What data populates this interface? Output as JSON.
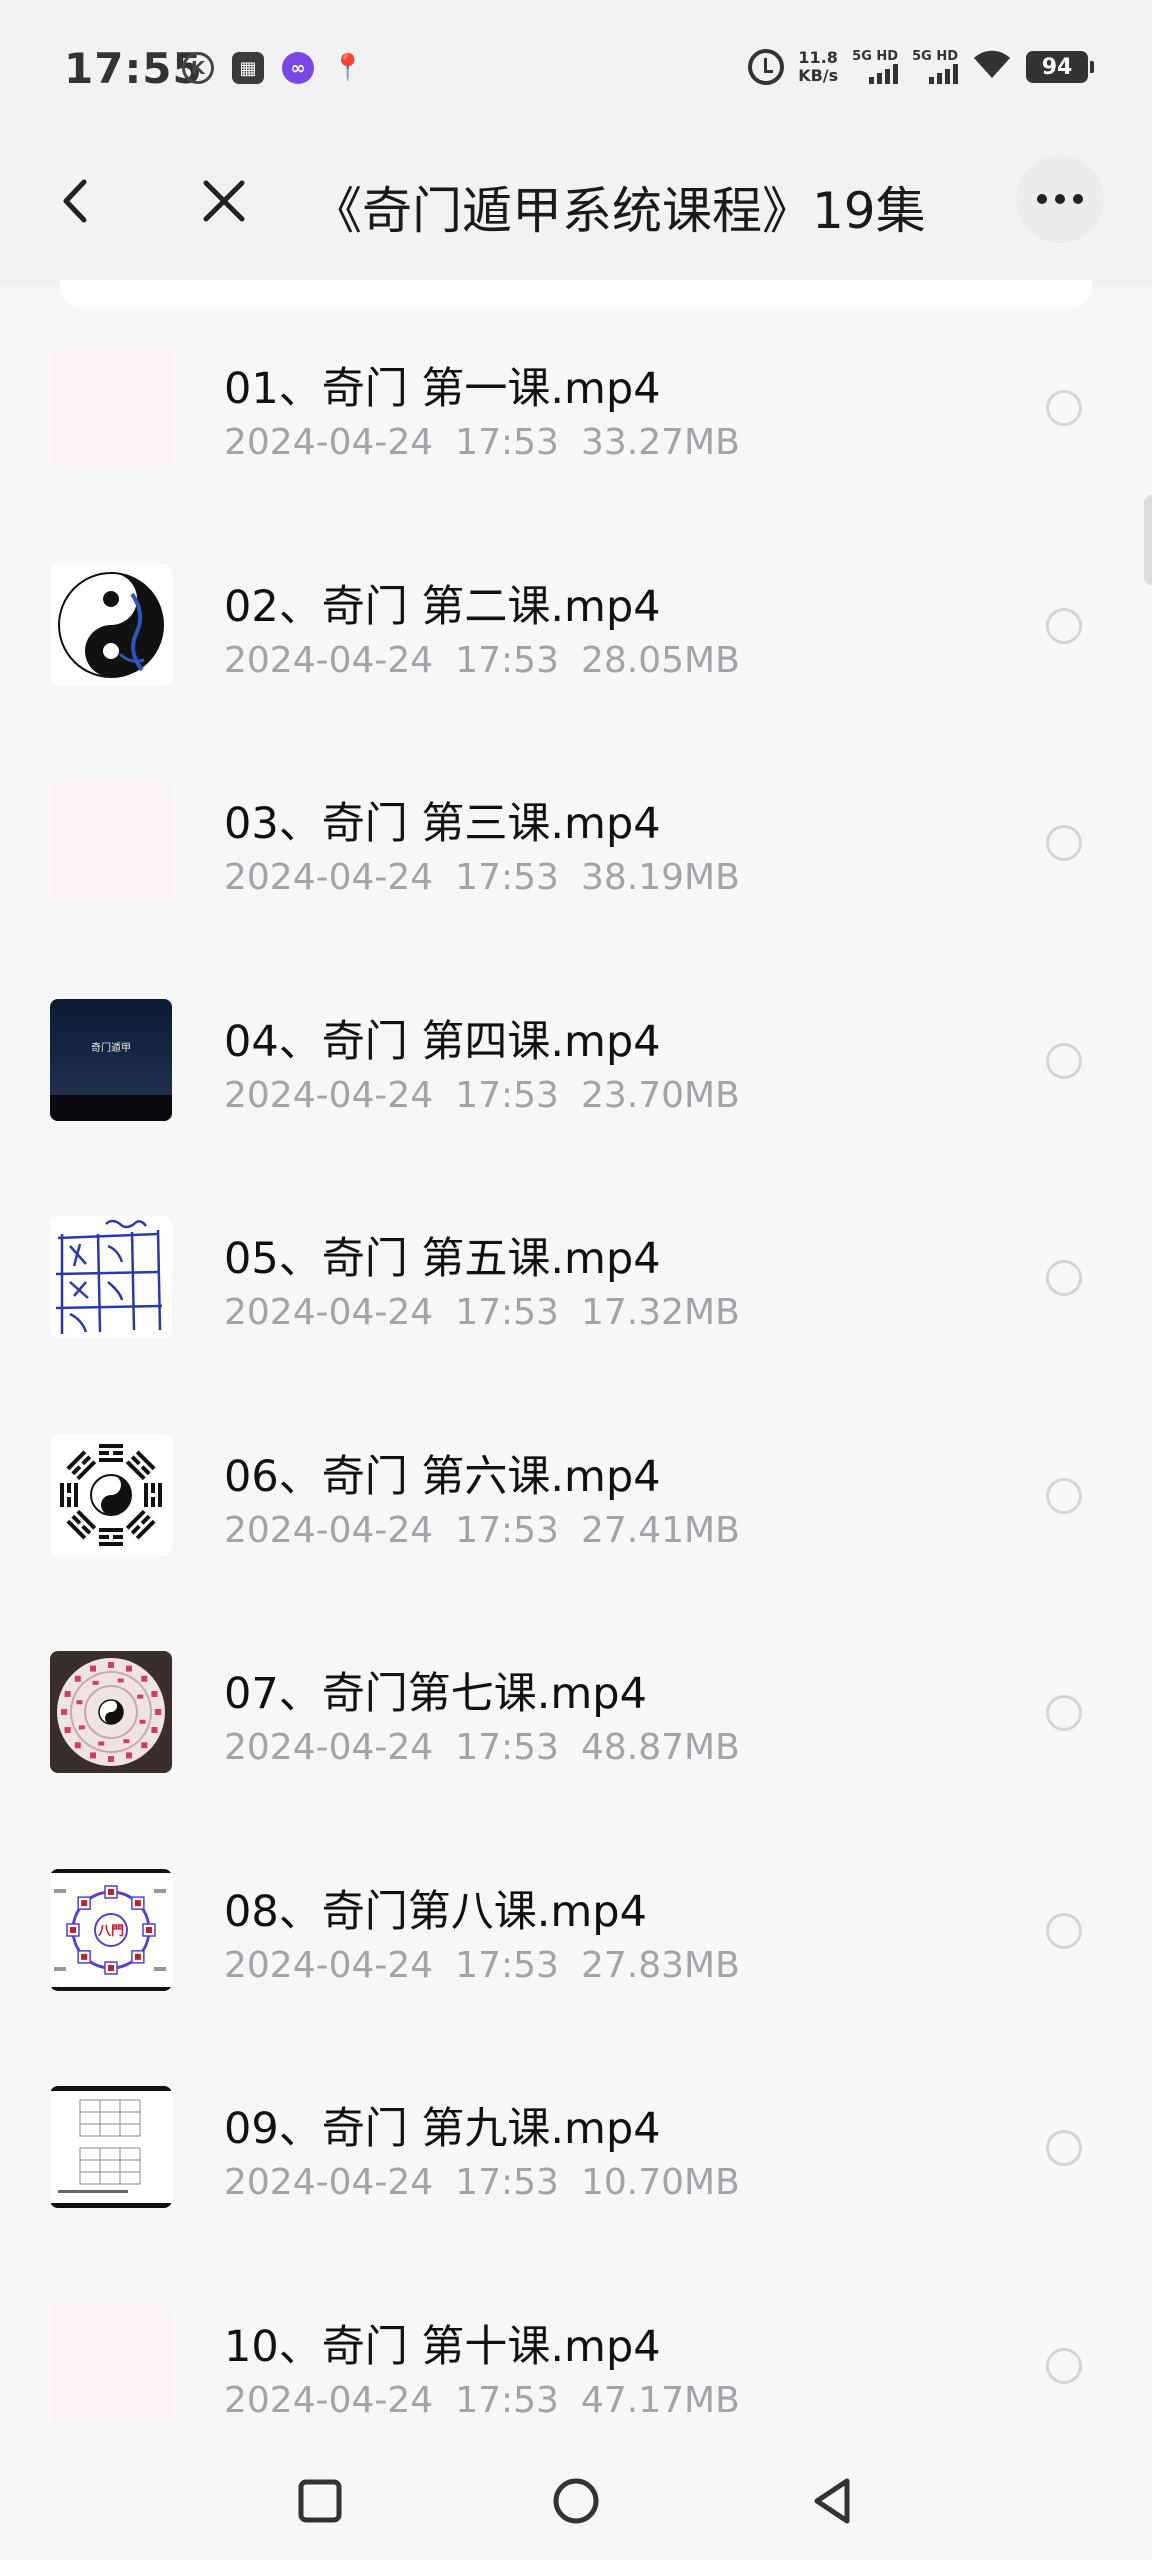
{
  "status_bar": {
    "time": "17:55",
    "left_icons": [
      "k-circle-icon",
      "gallery-icon",
      "link-app-icon",
      "location-pin-icon"
    ],
    "speed_value": "11.8",
    "speed_unit": "KB/s",
    "signal1_label": "5G HD",
    "signal2_label": "5G HD",
    "battery": "94"
  },
  "header": {
    "title": "《奇门遁甲系统课程》19集",
    "back_icon": "chevron-left-icon",
    "close_icon": "close-icon",
    "more_icon": "more-horizontal-icon"
  },
  "files": [
    {
      "name": "01、奇门 第一课.mp4",
      "date": "2024-04-24",
      "time": "17:53",
      "size": "33.27MB",
      "thumb": "blank"
    },
    {
      "name": "02、奇门 第二课.mp4",
      "date": "2024-04-24",
      "time": "17:53",
      "size": "28.05MB",
      "thumb": "taiji"
    },
    {
      "name": "03、奇门 第三课.mp4",
      "date": "2024-04-24",
      "time": "17:53",
      "size": "38.19MB",
      "thumb": "blank"
    },
    {
      "name": "04、奇门 第四课.mp4",
      "date": "2024-04-24",
      "time": "17:53",
      "size": "23.70MB",
      "thumb": "dark-sky"
    },
    {
      "name": "05、奇门 第五课.mp4",
      "date": "2024-04-24",
      "time": "17:53",
      "size": "17.32MB",
      "thumb": "handwritten-grid"
    },
    {
      "name": "06、奇门 第六课.mp4",
      "date": "2024-04-24",
      "time": "17:53",
      "size": "27.41MB",
      "thumb": "bagua"
    },
    {
      "name": "07、奇门第七课.mp4",
      "date": "2024-04-24",
      "time": "17:53",
      "size": "48.87MB",
      "thumb": "compass"
    },
    {
      "name": "08、奇门第八课.mp4",
      "date": "2024-04-24",
      "time": "17:53",
      "size": "27.83MB",
      "thumb": "bamen"
    },
    {
      "name": "09、奇门 第九课.mp4",
      "date": "2024-04-24",
      "time": "17:53",
      "size": "10.70MB",
      "thumb": "table-doc"
    },
    {
      "name": "10、奇门 第十课.mp4",
      "date": "2024-04-24",
      "time": "17:53",
      "size": "47.17MB",
      "thumb": "blank"
    }
  ],
  "thumb_text": {
    "dark_sky": "奇门遁甲",
    "bamen": "八門"
  },
  "navbar": {
    "recents_icon": "square-icon",
    "home_icon": "circle-icon",
    "back_icon": "triangle-back-icon"
  },
  "colors": {
    "meta_text": "#a3a3a8",
    "radio_border": "#d6d6da",
    "blank_thumb": "#fbf3f7",
    "link_app": "#7a46e6"
  }
}
